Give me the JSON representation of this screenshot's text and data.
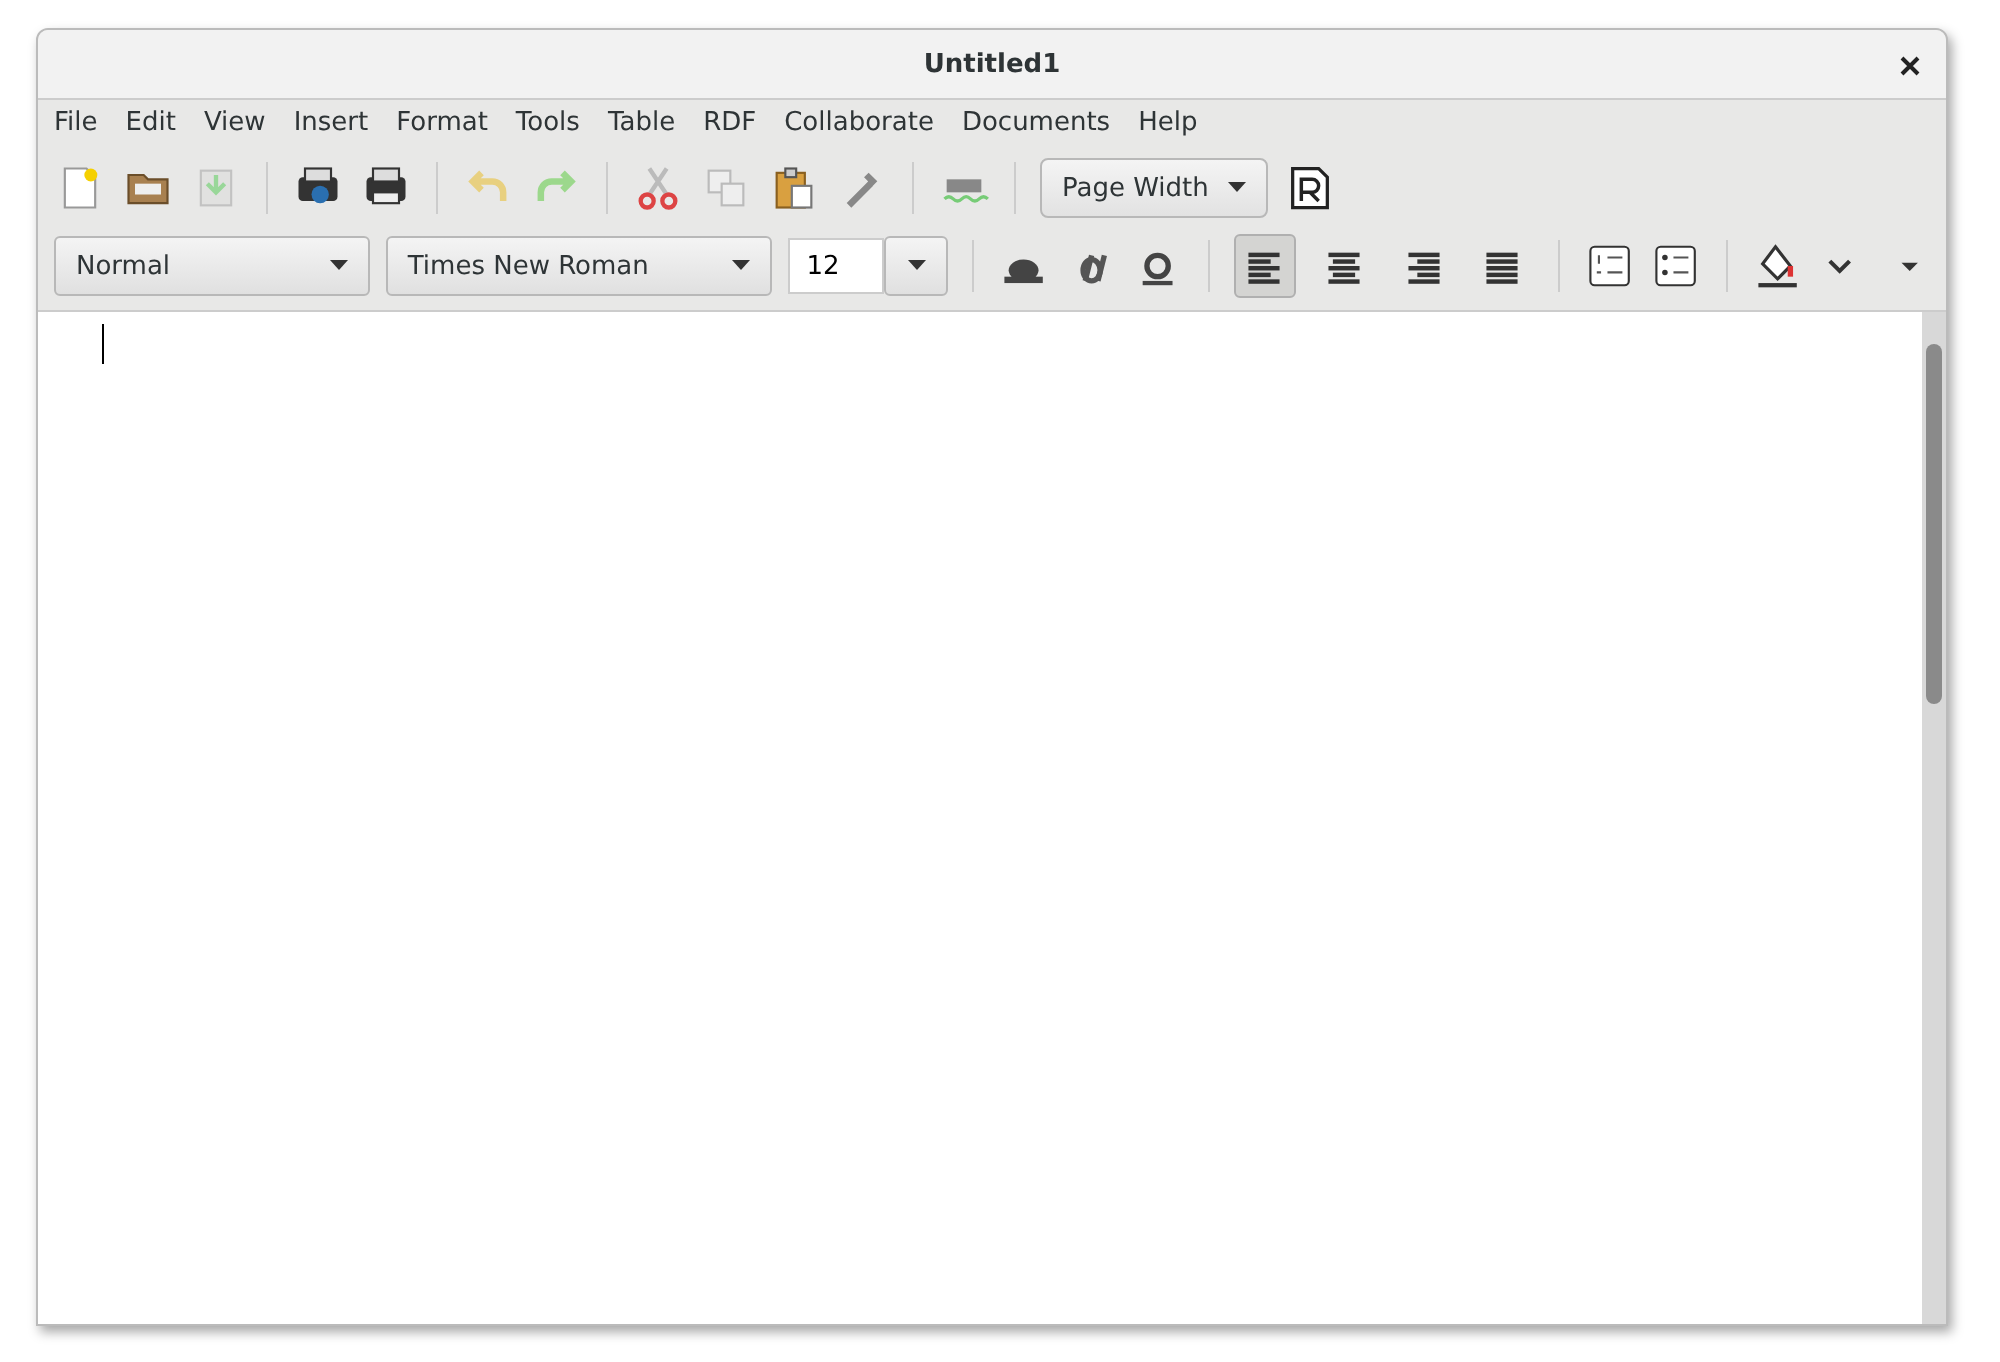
{
  "window": {
    "title": "Untitled1"
  },
  "menu": [
    "File",
    "Edit",
    "View",
    "Insert",
    "Format",
    "Tools",
    "Table",
    "RDF",
    "Collaborate",
    "Documents",
    "Help"
  ],
  "toolbar": {
    "zoom": "Page Width"
  },
  "format_bar": {
    "style": "Normal",
    "font": "Times New Roman",
    "size": "12",
    "alignment": [
      {
        "kind": "left",
        "selected": true
      },
      {
        "kind": "center",
        "selected": false
      },
      {
        "kind": "right",
        "selected": false
      },
      {
        "kind": "justify",
        "selected": false
      }
    ]
  }
}
